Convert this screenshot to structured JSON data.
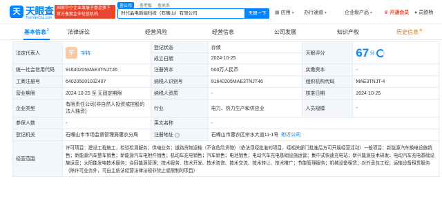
{
  "header": {
    "logo_mark": "天",
    "logo_text": "天眼查",
    "logo_url": "TianYanCha.com",
    "promo_line1": "国家中小企业发展子基金旗下",
    "promo_line2": "官方备案企业征信机构",
    "search_tabs": [
      "查公司",
      "查老板",
      "查关系"
    ],
    "search_value": "时代晶电新能科技（石嘴山）有限公司",
    "search_button": "天眼一下",
    "nav": {
      "app": "应用",
      "tongdao": "办行通道",
      "enterprise": "企业级产品",
      "vip": "开通会员",
      "user": "员欧杨"
    }
  },
  "tabs": {
    "items": [
      {
        "label": "基本信息",
        "sup": "2"
      },
      {
        "label": "法律诉讼",
        "sup": ""
      },
      {
        "label": "经营风险",
        "sup": ""
      },
      {
        "label": "经营信息",
        "sup": ""
      },
      {
        "label": "公司发展",
        "sup": ""
      },
      {
        "label": "知识产权",
        "sup": ""
      },
      {
        "label": "历史信息",
        "sup": ""
      }
    ]
  },
  "info": {
    "legal_rep_label": "法定代表人",
    "avatar_char": "宇",
    "legal_rep_name": "宇特",
    "reg_status_label": "登记状态",
    "reg_status": "存续",
    "eye_score_label": "天眼评分",
    "eye_score": "67",
    "eye_score_unit": "分",
    "founded_label": "成立日期",
    "founded": "2024-10-25",
    "credit_code_label": "统一社会信用代码",
    "credit_code": "91640205MAE3TNJT46",
    "reg_capital_label": "注册资本",
    "reg_capital": "500万人民币",
    "paid_capital_label": "实缴资本",
    "paid_capital": "-",
    "biz_reg_no_label": "工商注册号",
    "biz_reg_no": "640205001032407",
    "taxpayer_id_label": "纳税人识别号",
    "taxpayer_id": "91640205MAE3TNJT46",
    "org_code_label": "组织机构代码",
    "org_code": "MAE3TNJT-4",
    "term_label": "营业期限",
    "term": "2024-10-25 至 无固定期限",
    "taxpayer_q_label": "纳税人资质",
    "taxpayer_q": "-",
    "approval_label": "核准日期",
    "approval": "2024-10-25",
    "type_label": "企业类型",
    "type": "有限责任公司(非自然人投资或控股的法人独资)",
    "industry_label": "行业",
    "industry": "电力、热力生产和供应业",
    "staff_label": "人员规模",
    "staff": "-",
    "insured_label": "参保人数",
    "insured": "-",
    "en_name_label": "英文名称",
    "en_name": "-",
    "authority_label": "登记机关",
    "authority": "石嘴山市市场监督管理局惠农分局",
    "address_label": "注册地址",
    "address": "石嘴山市惠农区宗水大道11-1号",
    "nearby_link": "附近公司",
    "scope_label": "经营范围",
    "scope": "许可项目：建设工程施工，检验检测服务；供电业务；道路货物运输（不含危险货物）（依法须经批准的项目，经相关部门批准后方可开展经营活动）一般项目：新能源汽车换电设施销售；新能源汽车整车销售；新能源汽车电附件销售；机动车充电销售；汽车销售；电池销售；电动汽车充电基础设施运营；集中式快速充电站；新兴能源技术研发；电动汽车充电基础设施运营；太阳能发电技术服务；合同能源管理；技术服务、技术开发、技术咨询、技术交流、技术转让、技术推广；节能管理服务；机械设备租赁；对外承包工程；运输设备租赁服务（除许可业务外，可自主依法经营法律法规非禁止或限制的项目）"
  }
}
